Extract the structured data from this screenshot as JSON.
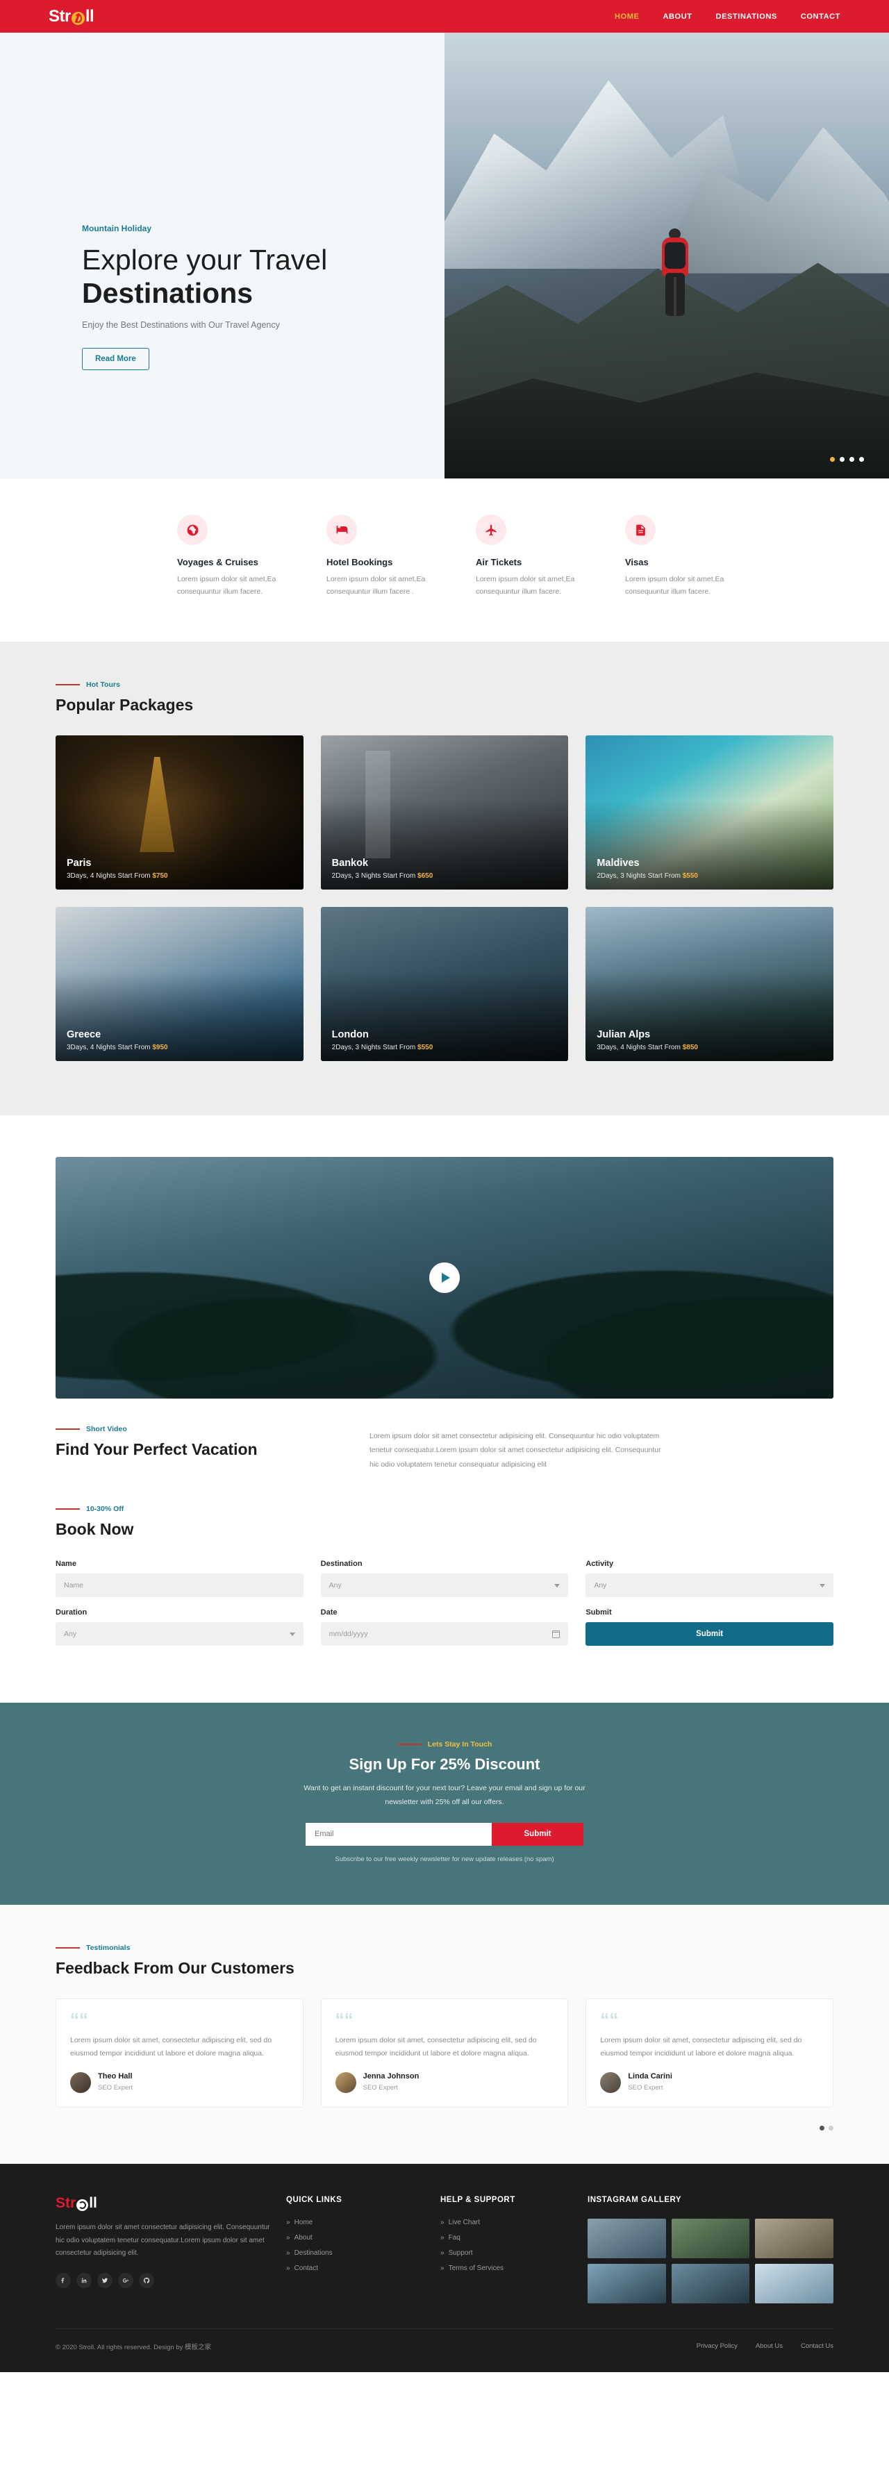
{
  "header": {
    "logo": {
      "pre": "Str",
      "globe_icon": "globe-icon",
      "post": "ll"
    },
    "nav": [
      {
        "label": "HOME",
        "active": true
      },
      {
        "label": "ABOUT",
        "active": false
      },
      {
        "label": "DESTINATIONS",
        "active": false
      },
      {
        "label": "CONTACT",
        "active": false
      }
    ]
  },
  "hero": {
    "eyebrow": "Mountain Holiday",
    "title_line1": "Explore your Travel",
    "title_line2": "Destinations",
    "subtitle": "Enjoy the Best Destinations with Our Travel Agency",
    "button": "Read More",
    "slider_dots": 4,
    "active_dot": 1
  },
  "services": [
    {
      "icon": "globe-cruise-icon",
      "title": "Voyages & Cruises",
      "text": "Lorem ipsum dolor sit amet,Ea consequuntur illum facere."
    },
    {
      "icon": "bed-icon",
      "title": "Hotel Bookings",
      "text": "Lorem ipsum dolor sit amet,Ea consequuntur illum facere ."
    },
    {
      "icon": "plane-icon",
      "title": "Air Tickets",
      "text": "Lorem ipsum dolor sit amet,Ea consequuntur illum facere."
    },
    {
      "icon": "document-icon",
      "title": "Visas",
      "text": "Lorem ipsum dolor sit amet,Ea consequuntur illum facere."
    }
  ],
  "packages": {
    "eyebrow": "Hot Tours",
    "title": "Popular Packages",
    "items": [
      {
        "name": "Paris",
        "duration": "3Days, 4 Nights Start From",
        "price": "$750"
      },
      {
        "name": "Bankok",
        "duration": "2Days, 3 Nights Start From",
        "price": "$650"
      },
      {
        "name": "Maldives",
        "duration": "2Days, 3 Nights Start From",
        "price": "$550"
      },
      {
        "name": "Greece",
        "duration": "3Days, 4 Nights Start From",
        "price": "$950"
      },
      {
        "name": "London",
        "duration": "2Days, 3 Nights Start From",
        "price": "$550"
      },
      {
        "name": "Julian Alps",
        "duration": "3Days, 4 Nights Start From",
        "price": "$850"
      }
    ]
  },
  "video": {
    "play_icon": "play-icon",
    "eyebrow": "Short Video",
    "title": "Find Your Perfect Vacation",
    "text": "Lorem ipsum dolor sit amet consectetur adipisicing elit. Consequuntur hic odio voluptatem tenetur consequatur.Lorem ipsum dolor sit amet consectetur adipisicing elit. Consequuntur hic odio voluptatem tenetur consequatur adipisicing elit"
  },
  "book": {
    "eyebrow": "10-30% Off",
    "title": "Book Now",
    "fields": [
      {
        "label": "Name",
        "value": "Name",
        "type": "text"
      },
      {
        "label": "Destination",
        "value": "Any",
        "type": "select"
      },
      {
        "label": "Activity",
        "value": "Any",
        "type": "select"
      },
      {
        "label": "Duration",
        "value": "Any",
        "type": "select"
      },
      {
        "label": "Date",
        "value": "mm/dd/yyyy",
        "type": "date"
      }
    ],
    "submit_label": "Submit",
    "submit_button": "Submit"
  },
  "newsletter": {
    "eyebrow": "Lets Stay In Touch",
    "title": "Sign Up For 25% Discount",
    "lead": "Want to get an instant discount for your next tour? Leave your email and sign up for our newsletter with 25% off all our offers.",
    "placeholder": "Email",
    "button": "Submit",
    "fine": "Subscribe to our free weekly newsletter for new update releases (no spam)"
  },
  "testimonials": {
    "eyebrow": "Testimonials",
    "title": "Feedback From Our Customers",
    "items": [
      {
        "text": "Lorem ipsum dolor sit amet, consectetur adipiscing elit, sed do eiusmod tempor incididunt ut labore et dolore magna aliqua.",
        "name": "Theo Hall",
        "role": "SEO Expert"
      },
      {
        "text": "Lorem ipsum dolor sit amet, consectetur adipiscing elit, sed do eiusmod tempor incididunt ut labore et dolore magna aliqua.",
        "name": "Jenna Johnson",
        "role": "SEO Expert"
      },
      {
        "text": "Lorem ipsum dolor sit amet, consectetur adipiscing elit, sed do eiusmod tempor incididunt ut labore et dolore magna aliqua.",
        "name": "Linda Carini",
        "role": "SEO Expert"
      }
    ]
  },
  "footer": {
    "logo": {
      "pre": "Str",
      "globe_icon": "globe-icon",
      "post": "ll"
    },
    "about": "Lorem ipsum dolor sit amet consectetur adipisicing elit. Consequuntur hic odio voluptatem tenetur consequatur.Lorem ipsum dolor sit amet consectetur adipisicing elit.",
    "socials": [
      "facebook-icon",
      "linkedin-icon",
      "twitter-icon",
      "google-plus-icon",
      "github-icon"
    ],
    "quick_links": {
      "title": "Quick Links",
      "items": [
        "Home",
        "About",
        "Destinations",
        "Contact"
      ]
    },
    "help": {
      "title": "Help & Support",
      "items": [
        "Live Chart",
        "Faq",
        "Support",
        "Terms of Services"
      ]
    },
    "instagram": {
      "title": "Instagram Gallery",
      "count": 6
    },
    "copyright": "© 2020 Stroll. All rights reserved. Design by 模板之家",
    "bottom_links": [
      "Privacy Policy",
      "About Us",
      "Contact Us"
    ]
  },
  "colors": {
    "brand_red": "#dd1b2e",
    "teal": "#1b7c92",
    "teal_dark": "#126b87",
    "newsletter_bg": "#48757a",
    "accent_yellow": "#f3b33d",
    "footer_bg": "#1c1c1c"
  }
}
